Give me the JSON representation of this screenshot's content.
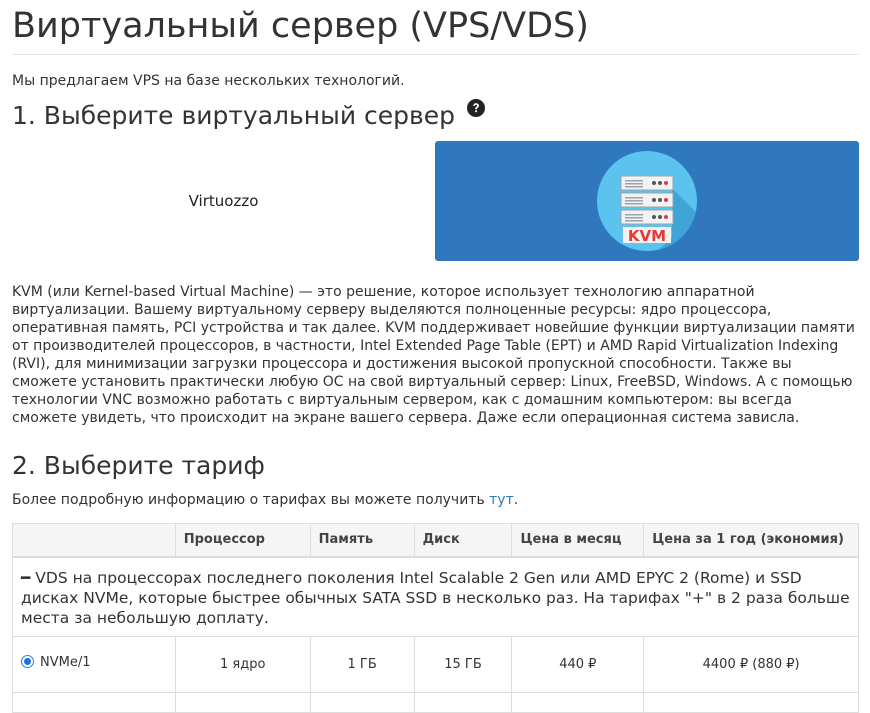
{
  "page": {
    "title": "Виртуальный сервер (VPS/VDS)",
    "intro": "Мы предлагаем VPS на базе нескольких технологий."
  },
  "step1": {
    "heading": "1. Выберите виртуальный сервер",
    "help_icon": "question-circle-icon",
    "options": [
      {
        "label": "Virtuozzo",
        "selected": false
      },
      {
        "label": "KVM",
        "selected": true
      }
    ],
    "description": "KVM (или Kernel-based Virtual Machine) — это решение, которое использует технологию аппаратной виртуализации. Вашему виртуальному серверу выделяются полноценные ресурсы: ядро процессора, оперативная память, PCI устройства и так далее. KVM поддерживает новейшие функции виртуализации памяти от производителей процессоров, в частности, Intel Extended Page Table (EPT) и AMD Rapid Virtualization Indexing (RVI), для минимизации загрузки процессора и достижения высокой пропускной способности. Также вы сможете установить практически любую ОС на свой виртуальный сервер: Linux, FreeBSD, Windows. А с помощью технологии VNC возможно работать с виртуальным сервером, как с домашним компьютером: вы всегда сможете увидеть, что происходит на экране вашего сервера. Даже если операционная система зависла."
  },
  "step2": {
    "heading": "2. Выберите тариф",
    "more_info_text": "Более подробную информацию о тарифах вы можете получить ",
    "more_info_link": "тут",
    "more_info_end": ".",
    "table": {
      "headers": [
        "",
        "Процессор",
        "Память",
        "Диск",
        "Цена в месяц",
        "Цена за 1 год (экономия)"
      ],
      "group": {
        "toggle_symbol": "━",
        "text": "VDS на процессорах последнего поколения Intel Scalable 2 Gen или AMD EPYC 2 (Rome) и SSD дисках NVMe, которые быстрее обычных SATA SSD в несколько раз. На тарифах \"+\" в 2 раза больше места за небольшую доплату."
      },
      "rows": [
        {
          "name": "NVMe/1",
          "cpu": "1 ядро",
          "ram": "1 ГБ",
          "disk": "15 ГБ",
          "price_month": "440 ₽",
          "price_year": "4400 ₽ (880 ₽)",
          "selected": true
        }
      ]
    }
  },
  "colors": {
    "kvm_tile_bg": "#3078bd",
    "kvm_circle": "#5cc3ee",
    "kvm_text": "#e53935",
    "link": "#337ab7"
  }
}
